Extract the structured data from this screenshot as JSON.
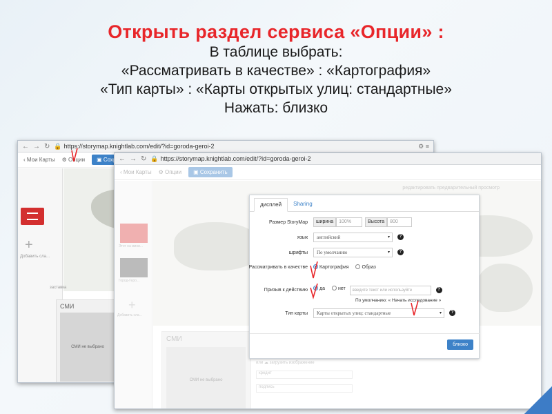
{
  "heading": {
    "title": "Открыть раздел сервиса «Опции» :",
    "lines": [
      "В таблице выбрать:",
      "«Рассматривать в качестве» : «Картография»",
      "«Тип карты» : «Карты открытых улиц: стандартные»",
      "Нажать: близко"
    ]
  },
  "colors": {
    "title": "#e8262a",
    "accent": "#3d82c8"
  },
  "back_window": {
    "url": "https://storymap.knightlab.com/edit/?id=goroda-geroi-2",
    "appbar": {
      "my_maps": "Мои Карты",
      "options": "Опции",
      "save": "Сохранить"
    },
    "add_slide_label": "Добавить сла...",
    "map_caption": "заставка",
    "media": {
      "label": "СМИ",
      "empty": "СМИ не выбрано"
    }
  },
  "front_window": {
    "url": "https://storymap.knightlab.com/edit/?id=goroda-geroi-2",
    "appbar": {
      "my_maps": "Мои Карты",
      "options": "Опции",
      "save": "Сохранить"
    },
    "top_links": "редактировать     предварительный просмотр",
    "thumb1_label": "Этот на мини...",
    "thumb2_label": "Город-Геро...",
    "add_slide_label": "Добавить сла...",
    "media": {
      "label": "СМИ",
      "empty": "СМИ не выбрано"
    },
    "upload": {
      "prefix": "или",
      "label": "загрузить изображение"
    },
    "form_fields": [
      "кредит",
      "подпись"
    ]
  },
  "dialog": {
    "tabs": [
      "дисплей",
      "Sharing"
    ],
    "size": {
      "label": "Размер StoryMap",
      "width_label": "ширина",
      "width_value": "100%",
      "height_label": "Высота",
      "height_value": "800"
    },
    "language": {
      "label": "язык",
      "value": "английский"
    },
    "fonts": {
      "label": "шрифты",
      "value": "По умолчанию"
    },
    "treat_as": {
      "label": "Рассматривать в качестве",
      "options": [
        "Картография",
        "Образ"
      ]
    },
    "cta": {
      "label": "Призыв к действию",
      "options": [
        "да",
        "нет"
      ],
      "placeholder": "введите текст или используйте",
      "default_hint": "По умолчанию: « Начать исследование »"
    },
    "map_type": {
      "label": "Тип карты",
      "value": "Карты открытых улиц: стандартные"
    },
    "help_glyph": "?",
    "close_button": "близко"
  },
  "icons": [
    "back-icon",
    "forward-icon",
    "reload-icon",
    "lock-icon",
    "gear-icon",
    "save-icon",
    "help-icon",
    "plus-icon",
    "caret-down-icon"
  ]
}
